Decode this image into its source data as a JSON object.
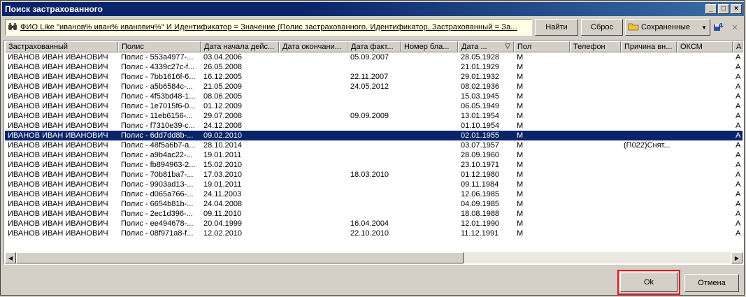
{
  "window": {
    "title": "Поиск застрахованного"
  },
  "toolbar": {
    "filter_text": "ФИО Like \"иванов% иван% иванович%\" И Идентификатор = Значение (Полис застрахованного, Идентификатор, Застрахованный = За...",
    "find_label": "Найти",
    "reset_label": "Сброс",
    "saved_label": "Сохраненные"
  },
  "table": {
    "columns": [
      "Застрахованный",
      "Полис",
      "Дата начала дейс...",
      "Дата окончани...",
      "Дата факт...",
      "Номер бла...",
      "Дата ...",
      "Пол",
      "Телефон",
      "Причина вн...",
      "ОКСМ",
      "А"
    ],
    "rows": [
      [
        "ИВАНОВ ИВАН ИВАНОВИЧ",
        "Полис - 553a4977-...",
        "03.04.2006",
        "",
        "05.09.2007",
        "",
        "28.05.1928",
        "М",
        "",
        "",
        "",
        "А"
      ],
      [
        "ИВАНОВ ИВАН ИВАНОВИЧ",
        "Полис - 4339c27c-f...",
        "26.05.2008",
        "",
        "",
        "",
        "21.01.1929",
        "М",
        "",
        "",
        "",
        "А"
      ],
      [
        "ИВАНОВ ИВАН ИВАНОВИЧ",
        "Полис - 7bb1616f-6...",
        "16.12.2005",
        "",
        "22.11.2007",
        "",
        "29.01.1932",
        "М",
        "",
        "",
        "",
        "А"
      ],
      [
        "ИВАНОВ ИВАН ИВАНОВИЧ",
        "Полис - a5b6584c-...",
        "21.05.2009",
        "",
        "24.05.2012",
        "",
        "08.02.1936",
        "М",
        "",
        "",
        "",
        "А"
      ],
      [
        "ИВАНОВ ИВАН ИВАНОВИЧ",
        "Полис - 4f53bd48-1...",
        "08.06.2005",
        "",
        "",
        "",
        "15.03.1945",
        "М",
        "",
        "",
        "",
        "А"
      ],
      [
        "ИВАНОВ ИВАН ИВАНОВИЧ",
        "Полис - 1e7015f6-0...",
        "01.12.2009",
        "",
        "",
        "",
        "06.05.1949",
        "М",
        "",
        "",
        "",
        "А"
      ],
      [
        "ИВАНОВ ИВАН ИВАНОВИЧ",
        "Полис - 11eb6156-...",
        "29.07.2008",
        "",
        "09.09.2009",
        "",
        "13.01.1954",
        "М",
        "",
        "",
        "",
        "А"
      ],
      [
        "ИВАНОВ ИВАН ИВАНОВИЧ",
        "Полис - f7310e39-c...",
        "24.12.2008",
        "",
        "",
        "",
        "01.10.1954",
        "М",
        "",
        "",
        "",
        "А"
      ],
      [
        "ИВАНОВ ИВАН ИВАНОВИЧ",
        "Полис - 6dd7dd8b-...",
        "09.02.2010",
        "",
        "",
        "",
        "02.01.1955",
        "М",
        "",
        "",
        "",
        "А"
      ],
      [
        "ИВАНОВ ИВАН ИВАНОВИЧ",
        "Полис - 48f5a6b7-a...",
        "28.10.2014",
        "",
        "",
        "",
        "03.07.1957",
        "М",
        "",
        "(П022)Снят...",
        "",
        "А"
      ],
      [
        "ИВАНОВ ИВАН ИВАНОВИЧ",
        "Полис - a9b4ac22-...",
        "19.01.2011",
        "",
        "",
        "",
        "28.09.1960",
        "М",
        "",
        "",
        "",
        "А"
      ],
      [
        "ИВАНОВ ИВАН ИВАНОВИЧ",
        "Полис - fb894963-2...",
        "15.02.2010",
        "",
        "",
        "",
        "23.10.1971",
        "М",
        "",
        "",
        "",
        "А"
      ],
      [
        "ИВАНОВ ИВАН ИВАНОВИЧ",
        "Полис - 70b81ba7-...",
        "17.03.2010",
        "",
        "18.03.2010",
        "",
        "01.12.1980",
        "М",
        "",
        "",
        "",
        "А"
      ],
      [
        "ИВАНОВ ИВАН ИВАНОВИЧ",
        "Полис - 9903ad13-...",
        "19.01.2011",
        "",
        "",
        "",
        "09.11.1984",
        "М",
        "",
        "",
        "",
        "А"
      ],
      [
        "ИВАНОВ ИВАН ИВАНОВИЧ",
        "Полис - d065a766-...",
        "24.11.2003",
        "",
        "",
        "",
        "12.06.1985",
        "М",
        "",
        "",
        "",
        "А"
      ],
      [
        "ИВАНОВ ИВАН ИВАНОВИЧ",
        "Полис - 6654b81b-...",
        "24.04.2008",
        "",
        "",
        "",
        "04.09.1985",
        "М",
        "",
        "",
        "",
        "А"
      ],
      [
        "ИВАНОВ ИВАН ИВАНОВИЧ",
        "Полис - 2ec1d396-...",
        "09.11.2010",
        "",
        "",
        "",
        "18.08.1988",
        "М",
        "",
        "",
        "",
        "А"
      ],
      [
        "ИВАНОВ ИВАН ИВАНОВИЧ",
        "Полис - ee494678-...",
        "20.04.1999",
        "",
        "16.04.2004",
        "",
        "12.01.1990",
        "М",
        "",
        "",
        "",
        "А"
      ],
      [
        "ИВАНОВ ИВАН ИВАНОВИЧ",
        "Полис - 08f971a8-f...",
        "12.02.2010",
        "",
        "22.10.2010",
        "",
        "11.12.1991",
        "М",
        "",
        "",
        "",
        "А"
      ]
    ],
    "selected_row": 8
  },
  "footer": {
    "ok_label": "Ok",
    "cancel_label": "Отмена"
  },
  "colors": {
    "selection": "#0a246a",
    "highlight_border": "#e8141e",
    "filter_bg": "#ffffe1"
  }
}
